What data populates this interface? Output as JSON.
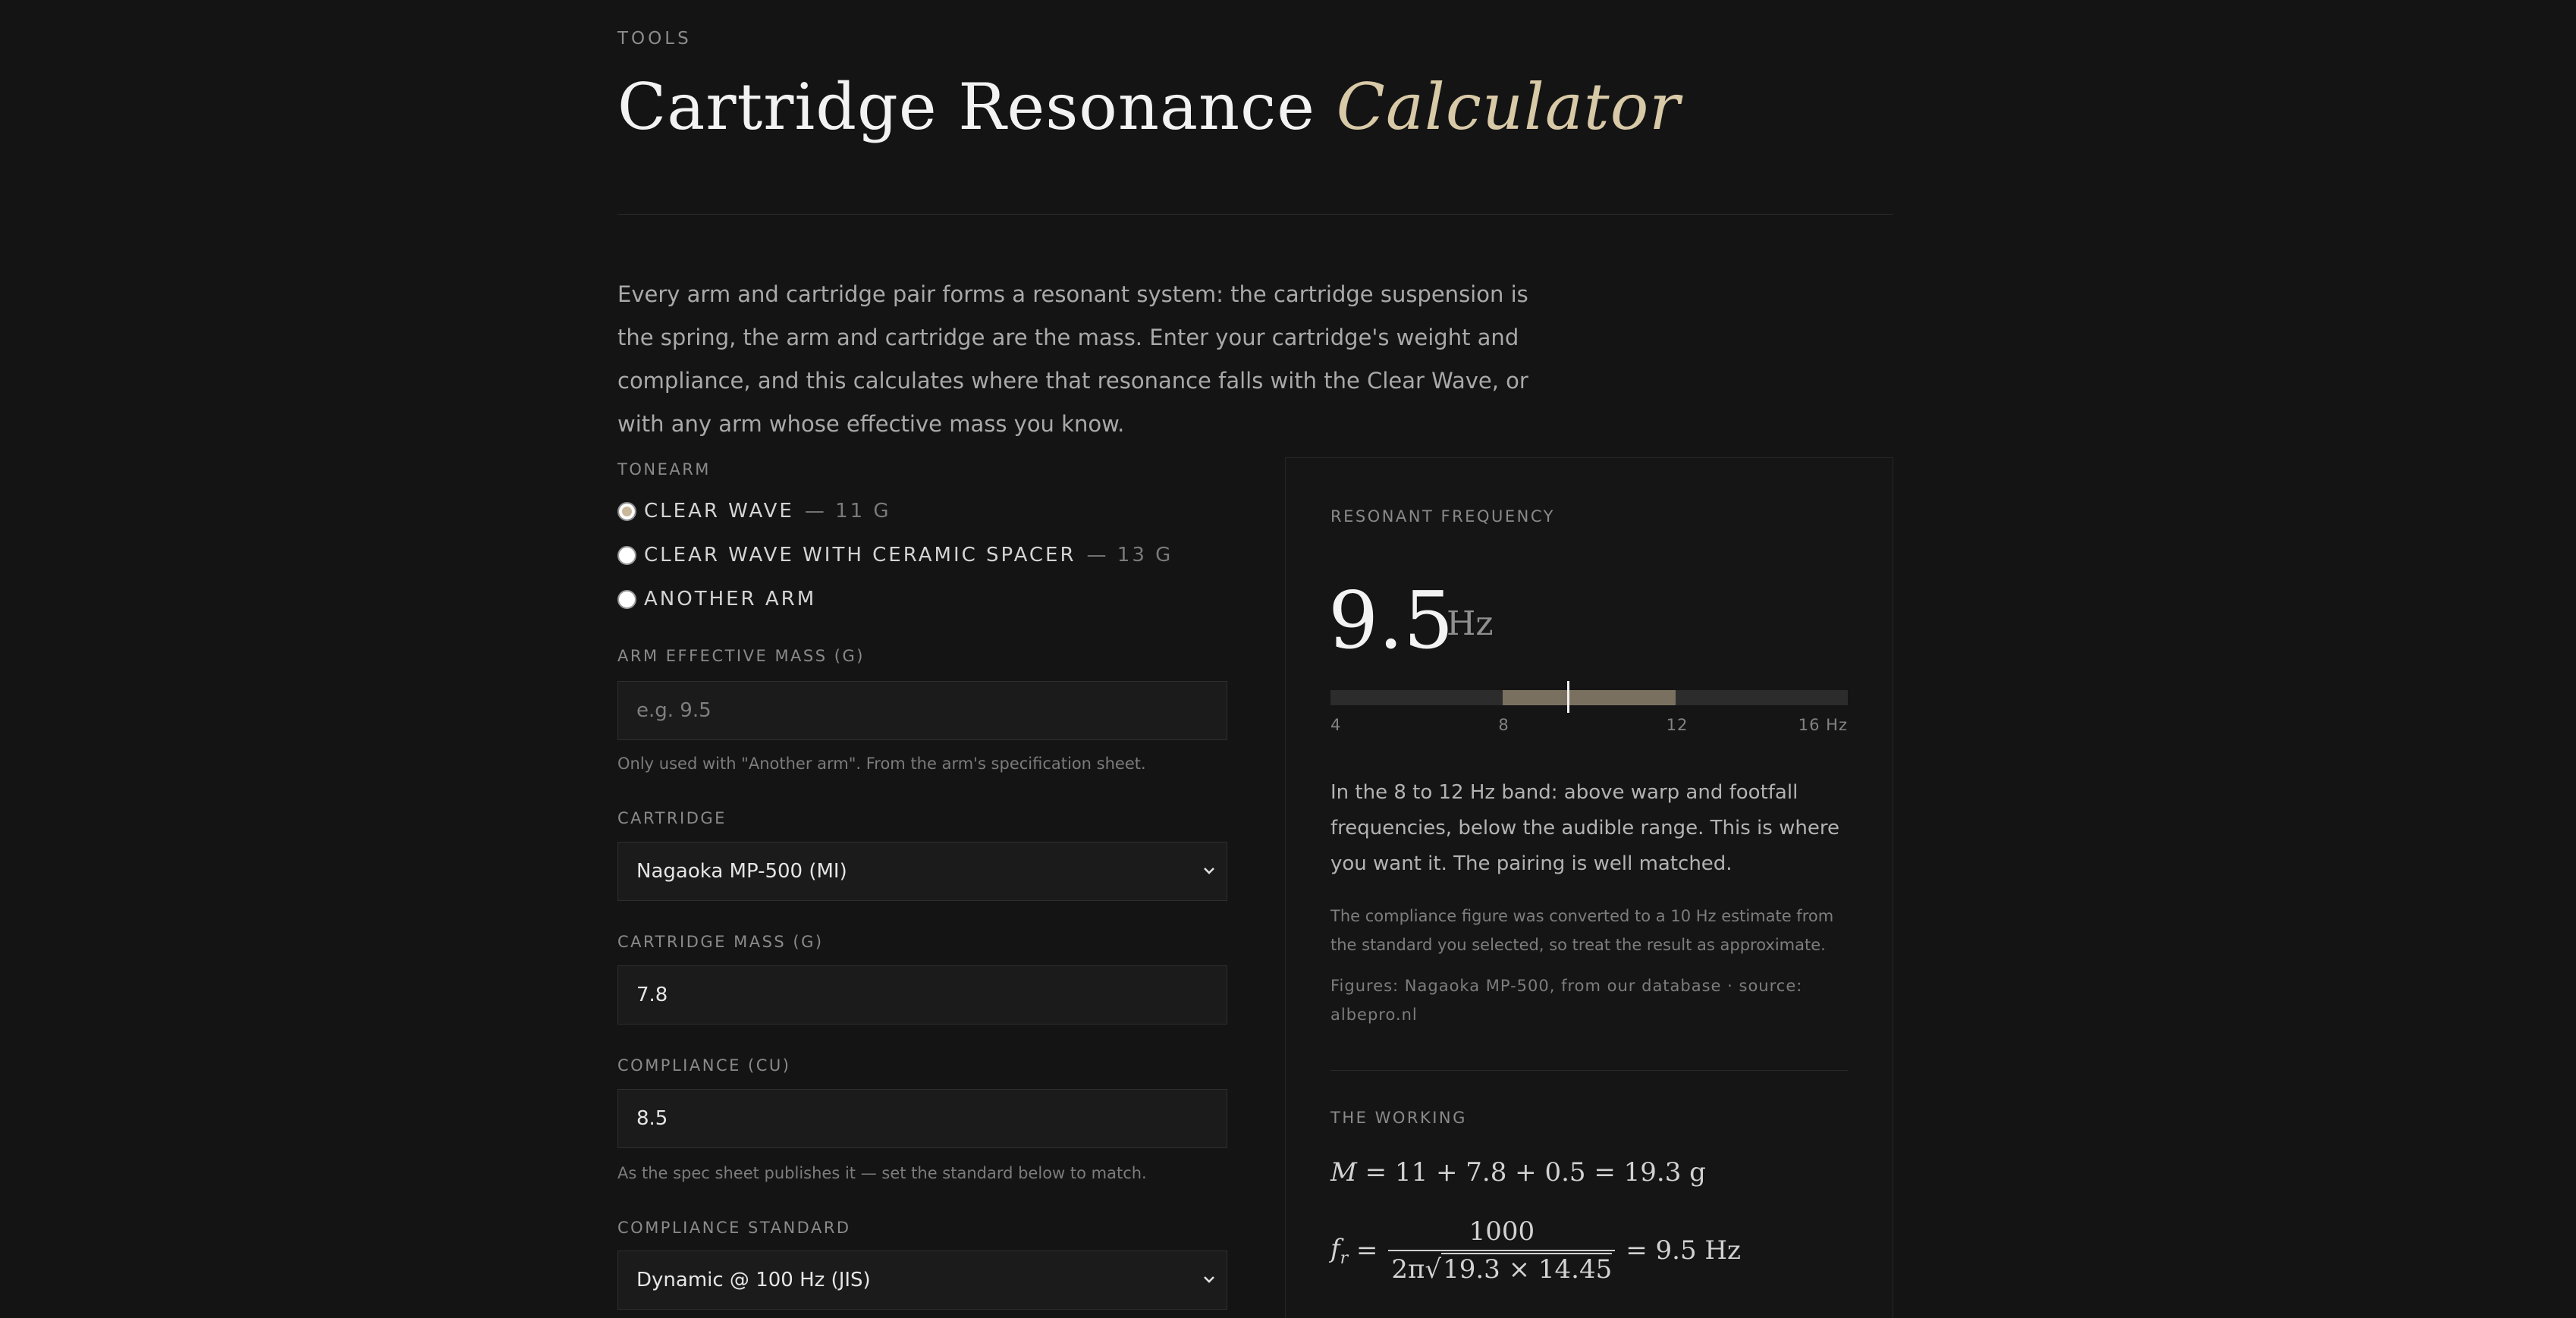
{
  "header": {
    "eyebrow": "TOOLS",
    "title_main": "Cartridge Resonance",
    "title_accent": "Calculator"
  },
  "intro": "Every arm and cartridge pair forms a resonant system: the cartridge suspension is the spring, the arm and cartridge are the mass. Enter your cartridge's weight and compliance, and this calculates where that resonance falls with the Clear Wave, or with any arm whose effective mass you know.",
  "form": {
    "tonearm": {
      "label": "TONEARM",
      "options": [
        {
          "label": "CLEAR WAVE",
          "note": "— 11 G",
          "checked": true
        },
        {
          "label": "CLEAR WAVE WITH CERAMIC SPACER",
          "note": "— 13 G",
          "checked": false
        },
        {
          "label": "ANOTHER ARM",
          "note": "",
          "checked": false
        }
      ]
    },
    "arm_mass": {
      "label": "ARM EFFECTIVE MASS (G)",
      "value": "",
      "placeholder": "e.g. 9.5",
      "hint": "Only used with \"Another arm\". From the arm's specification sheet."
    },
    "cartridge": {
      "label": "CARTRIDGE",
      "selected": "Nagaoka MP-500 (MI)"
    },
    "cartridge_mass": {
      "label": "CARTRIDGE MASS (G)",
      "value": "7.8"
    },
    "compliance": {
      "label": "COMPLIANCE (CU)",
      "value": "8.5",
      "hint": "As the spec sheet publishes it — set the standard below to match."
    },
    "compliance_standard": {
      "label": "COMPLIANCE STANDARD",
      "selected": "Dynamic @ 100 Hz (JIS)"
    }
  },
  "result": {
    "label": "RESONANT FREQUENCY",
    "value": "9.5",
    "unit": "Hz",
    "scale": {
      "min": 4,
      "max": 16,
      "band_low": 8,
      "band_high": 12,
      "marker": 9.5,
      "ticks": [
        "4",
        "8",
        "12",
        "16 Hz"
      ]
    },
    "verdict": "In the 8 to 12 Hz band: above warp and footfall frequencies, below the audible range. This is where you want it. The pairing is well matched.",
    "conversion_note": "The compliance figure was converted to a 10 Hz estimate from the standard you selected, so treat the result as approximate.",
    "figures_note": "Figures: Nagaoka MP-500, from our database · source: albepro.nl"
  },
  "working": {
    "label": "THE WORKING",
    "mass_eq": "= 11 + 7.8 + 0.5 = 19.3 g",
    "freq_num": "1000",
    "freq_den_prefix": "2π",
    "freq_den_sqrt": "19.3 × 14.45",
    "freq_result": "= 9.5 Hz"
  },
  "colors": {
    "background": "#141414",
    "accent": "#d8c9a7",
    "band": "#7a705f"
  }
}
